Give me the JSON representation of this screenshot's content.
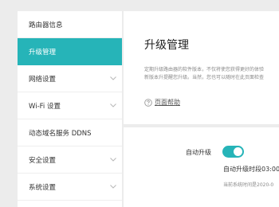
{
  "sidebar": {
    "items": [
      {
        "label": "路由器信息",
        "active": false,
        "has_chevron": false
      },
      {
        "label": "升级管理",
        "active": true,
        "has_chevron": false
      },
      {
        "label": "网络设置",
        "active": false,
        "has_chevron": true
      },
      {
        "label": "Wi-Fi 设置",
        "active": false,
        "has_chevron": true
      },
      {
        "label": "动态域名服务 DDNS",
        "active": false,
        "has_chevron": false
      },
      {
        "label": "安全设置",
        "active": false,
        "has_chevron": true
      },
      {
        "label": "系统设置",
        "active": false,
        "has_chevron": true
      }
    ]
  },
  "main": {
    "title": "升级管理",
    "description_line1": "定期升级路由器的软件版本，不仅将使您获得更好的体验",
    "description_line2": "新版本升提醒您升级。当然，您也可以随时在此页面检查",
    "help_link": "页面帮助",
    "auto_upgrade_label": "自动升级",
    "auto_upgrade_enabled": true,
    "upgrade_period": "自动升级时段03:00",
    "system_time": "当前系统时间是2020-0"
  },
  "colors": {
    "accent": "#26b4b8",
    "background": "#ececec"
  },
  "icons": {
    "chevron": "chevron-down-icon",
    "help": "question-circle-icon"
  }
}
